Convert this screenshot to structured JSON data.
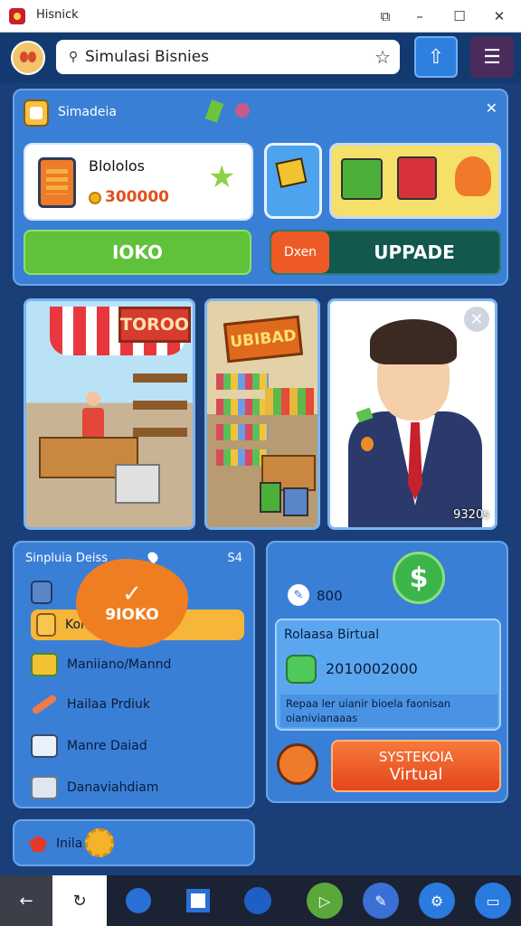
{
  "window": {
    "title": "Hisnick",
    "minimize": "–",
    "maximize": "☐",
    "close": "✕",
    "screenshot_icon": "⧉"
  },
  "header": {
    "search_text": "Simulasi Bisnies",
    "search_icon": "⚲",
    "star_icon": "☆",
    "share_icon": "⇧",
    "menu_icon": "☰"
  },
  "top_panel": {
    "title": "Simadeia",
    "close": "✕",
    "balance": {
      "label": "Blololos",
      "value": "300000"
    },
    "ok_button": "IOKO",
    "split_button": {
      "left": "Dxen",
      "right": "UPPADE"
    }
  },
  "scenes": {
    "store_sign": "TOROO",
    "stall_sign": "UBIBAD",
    "close": "✕",
    "counter": "9320s"
  },
  "menu": {
    "title": "Sinpluia Deiss",
    "close": "S4",
    "badge": "9IOKO",
    "badge_check": "✓",
    "items": [
      {
        "label": ""
      },
      {
        "label": "Kom"
      },
      {
        "label": "Maniiano/Mannd"
      },
      {
        "label": "Hailaa Prdiuk"
      },
      {
        "label": "Manre Daiad"
      },
      {
        "label": "Danaviahdiam"
      }
    ]
  },
  "right": {
    "score": "800",
    "dollar": "$",
    "sub_title": "Rolaasa Birtual",
    "sub_value": "2010002000",
    "sub_desc": "Repaa ler uianir bioela faonisan oianivianaaas",
    "virtual_button": {
      "line1": "SYSTEKOIA",
      "line2": "Virtual"
    }
  },
  "bottom": {
    "label": "Inila"
  },
  "taskbar": {
    "back": "←",
    "refresh": "↻",
    "play": "▷",
    "settings": "⚙",
    "chat": "▭"
  },
  "colors": {
    "accent": "#3a7fd6",
    "primary_green": "#5fc23a",
    "primary_orange": "#ee5a25",
    "dark_teal": "#12584f"
  }
}
